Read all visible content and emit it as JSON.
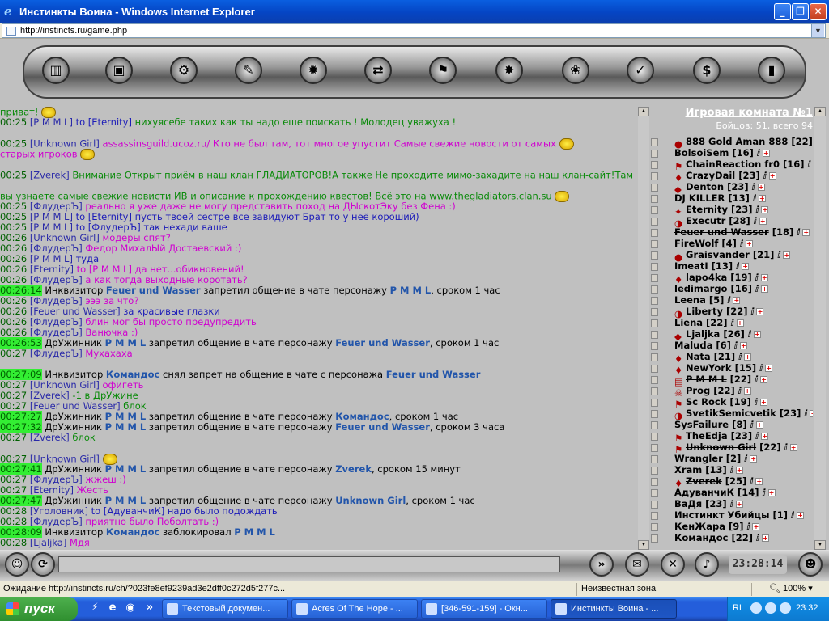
{
  "window": {
    "title": "Инстинкты Воина - Windows Internet Explorer",
    "address": "http://instincts.ru/game.php",
    "minimize": "_",
    "maximize": "❐",
    "close": "✕"
  },
  "nav": {
    "icons": [
      "rainbow-icon",
      "card-icon",
      "gear-icon",
      "sword-icon",
      "spider-icon",
      "arrows-icon",
      "flag-icon",
      "star-icon",
      "flower-icon",
      "check-icon",
      "dollar-icon",
      "door-icon"
    ],
    "glyphs": [
      "▥",
      "▣",
      "⚙",
      "✎",
      "✹",
      "⇄",
      "⚑",
      "✸",
      "❀",
      "✓",
      "$",
      "▮"
    ]
  },
  "chat": [
    {
      "time": "",
      "nick": "",
      "text": "приват!",
      "cls": "msg-gr",
      "smile": true
    },
    {
      "time": "00:25",
      "nick": "[P M M L]",
      "to": " to [Eternity] ",
      "text": "нихуясебе таких как ты надо еше поискать ! Молодец уважуха !",
      "cls": "msg-gr"
    },
    {
      "time": "",
      "nick": "",
      "text": "",
      "cls": ""
    },
    {
      "time": "00:25",
      "nick": "[Unknown Girl]",
      "text": "assassinsguild.ucoz.ru/ Кто не был там, тот многое упустит  Самые свежие новости от самых",
      "cls": "msg-mg",
      "smile": true
    },
    {
      "time": "",
      "nick": "",
      "text": "старых игроков",
      "cls": "msg-mg",
      "smile": true
    },
    {
      "time": "",
      "nick": "",
      "text": "",
      "cls": ""
    },
    {
      "time": "00:25",
      "nick": "[Zverek]",
      "text": "Внимание Открыт приём в наш клан ГЛАДИАТОРОВ!А также Не проходите мимо-захадите на наш клан-сайт!Там",
      "cls": "msg-gr",
      "smile": true
    },
    {
      "time": "",
      "nick": "",
      "text": "",
      "cls": ""
    },
    {
      "time": "",
      "nick": "",
      "text": "вы узнаете самые свежие новисти ИВ и описание к прохождению квестов! Всё это на www.thegladiators.clan.su",
      "cls": "msg-gr",
      "smile": true
    },
    {
      "time": "00:25",
      "nick": "[ФлудерЪ]",
      "text": "реально я уже даже не могу представить поход на ДЫскотЭку без Фена :)",
      "cls": "msg-mg"
    },
    {
      "time": "00:25",
      "nick": "[P M M L]",
      "to": " to [Eternity] ",
      "text": "пусть твоей сестре все завидуют Брат то у неё короший)",
      "cls": "msg-bl"
    },
    {
      "time": "00:25",
      "nick": "[P M M L]",
      "to": " to [ФлудерЪ] ",
      "text": "так нехади ваше",
      "cls": "msg-bl"
    },
    {
      "time": "00:26",
      "nick": "[Unknown Girl]",
      "text": "модеры спят?",
      "cls": "msg-mg"
    },
    {
      "time": "00:26",
      "nick": "[ФлудерЪ]",
      "text": "Федор МихалЫй Достаевский :)",
      "cls": "msg-mg"
    },
    {
      "time": "00:26",
      "nick": "[P M M L]",
      "text": "туда",
      "cls": "msg-bl"
    },
    {
      "time": "00:26",
      "nick": "[Eternity]",
      "text": "to [P M M L] да нет...обикновений!",
      "cls": "msg-mg"
    },
    {
      "time": "00:26",
      "nick": "[ФлудерЪ]",
      "text": "а как тогда выходные коротать?",
      "cls": "msg-mg"
    },
    {
      "time": "00:26:14",
      "hl": true,
      "sys": "Инквизитор ",
      "p1": "Feuer und Wasser",
      "mid": " запретил общение в чате персонажу ",
      "p2": "P M M L",
      "end": ", сроком 1 час"
    },
    {
      "time": "00:26",
      "nick": "[ФлудерЪ]",
      "text": "эээ за что?",
      "cls": "msg-mg"
    },
    {
      "time": "00:26",
      "nick": "[Feuer und Wasser]",
      "text": "за красивые глазки",
      "cls": "msg-bl"
    },
    {
      "time": "00:26",
      "nick": "[ФлудерЪ]",
      "text": "блин мог бы просто предупредить",
      "cls": "msg-mg"
    },
    {
      "time": "00:26",
      "nick": "[ФлудерЪ]",
      "text": "Ванючка :)",
      "cls": "msg-mg"
    },
    {
      "time": "00:26:53",
      "hl": true,
      "sys": "ДрУжинник ",
      "p1": "P M M L",
      "mid": " запретил общение в чате персонажу ",
      "p2": "Feuer und Wasser",
      "end": ", сроком 1 час"
    },
    {
      "time": "00:27",
      "nick": "[ФлудерЪ]",
      "text": "Мухахаха",
      "cls": "msg-mg"
    },
    {
      "time": "",
      "nick": "",
      "text": "",
      "cls": ""
    },
    {
      "time": "00:27:09",
      "hl": true,
      "sys": "Инквизитор ",
      "p1": "Командос",
      "mid": " снял запрет на общение в чате с персонажа ",
      "p2": "Feuer und Wasser",
      "end": ""
    },
    {
      "time": "00:27",
      "nick": "[Unknown Girl]",
      "text": "офигеть",
      "cls": "msg-mg"
    },
    {
      "time": "00:27",
      "nick": "[Zverek]",
      "text": "-1 в ДрУжине",
      "cls": "msg-gr"
    },
    {
      "time": "00:27",
      "nick": "[Feuer und Wasser]",
      "text": "блок",
      "cls": "msg-gr"
    },
    {
      "time": "00:27:27",
      "hl": true,
      "sys": "ДрУжинник ",
      "p1": "P M M L",
      "mid": " запретил общение в чате персонажу ",
      "p2": "Командос",
      "end": ", сроком 1 час"
    },
    {
      "time": "00:27:32",
      "hl": true,
      "sys": "ДрУжинник ",
      "p1": "P M M L",
      "mid": " запретил общение в чате персонажу ",
      "p2": "Feuer und Wasser",
      "end": ", сроком 3 часа"
    },
    {
      "time": "00:27",
      "nick": "[Zverek]",
      "text": "блок",
      "cls": "msg-gr"
    },
    {
      "time": "",
      "nick": "",
      "text": "",
      "cls": ""
    },
    {
      "time": "00:27",
      "nick": "[Unknown Girl]",
      "text": "",
      "cls": "msg-mg",
      "smile": true
    },
    {
      "time": "00:27:41",
      "hl": true,
      "sys": "ДрУжинник ",
      "p1": "P M M L",
      "mid": " запретил общение в чате персонажу ",
      "p2": "Zverek",
      "end": ", сроком 15 минут"
    },
    {
      "time": "00:27",
      "nick": "[ФлудерЪ]",
      "text": "жжеш :)",
      "cls": "msg-mg"
    },
    {
      "time": "00:27",
      "nick": "[Eternity]",
      "text": "Жесть",
      "cls": "msg-mg"
    },
    {
      "time": "00:27:47",
      "hl": true,
      "sys": "ДрУжинник ",
      "p1": "P M M L",
      "mid": " запретил общение в чате персонажу ",
      "p2": "Unknown Girl",
      "end": ", сроком 1 час"
    },
    {
      "time": "00:28",
      "nick": "[Уголовник]",
      "to": " to [АдуванчиК] ",
      "text": "надо было подождать",
      "cls": "msg-bl"
    },
    {
      "time": "00:28",
      "nick": "[ФлудерЪ]",
      "text": "приятно было Поболтать :)",
      "cls": "msg-mg"
    },
    {
      "time": "00:28:09",
      "hl": true,
      "sys": "Инквизитор ",
      "p1": "Командос",
      "mid": " заблокировал ",
      "p2": "P M M L",
      "end": ""
    },
    {
      "time": "00:28",
      "nick": "[Ljaljka]",
      "text": "Мдя",
      "cls": "msg-mg"
    }
  ],
  "room": {
    "title": "Игровая комната №1",
    "stats": "Бойцов: 51, всего 94"
  },
  "players": [
    {
      "name": "888 Gold Aman 888",
      "lvl": "[22]",
      "icon": "clan"
    },
    {
      "name": "BolsoiSem",
      "lvl": "[16]",
      "icon": ""
    },
    {
      "name": "ChainReaction fr0",
      "lvl": "[16]",
      "icon": "ghost"
    },
    {
      "name": "CrazyDail",
      "lvl": "[23]",
      "icon": "shield"
    },
    {
      "name": "Denton",
      "lvl": "[23]",
      "icon": "clan2"
    },
    {
      "name": "DJ KILLER",
      "lvl": "[13]",
      "icon": ""
    },
    {
      "name": "Eternity",
      "lvl": "[23]",
      "icon": "clan3"
    },
    {
      "name": "Executr",
      "lvl": "[28]",
      "icon": "clan4"
    },
    {
      "name": "Feuer und Wasser",
      "lvl": "[18]",
      "icon": "",
      "strike": true
    },
    {
      "name": "FireWolf",
      "lvl": "[4]",
      "icon": ""
    },
    {
      "name": "Graisvander",
      "lvl": "[21]",
      "icon": "clan"
    },
    {
      "name": "ImeatI",
      "lvl": "[13]",
      "icon": ""
    },
    {
      "name": "lapo4ka",
      "lvl": "[19]",
      "icon": "shield"
    },
    {
      "name": "ledimargo",
      "lvl": "[16]",
      "icon": ""
    },
    {
      "name": "Leena",
      "lvl": "[5]",
      "icon": ""
    },
    {
      "name": "Liberty",
      "lvl": "[22]",
      "icon": "clan4"
    },
    {
      "name": "Liena",
      "lvl": "[22]",
      "icon": ""
    },
    {
      "name": "Ljaljka",
      "lvl": "[26]",
      "icon": "clan2"
    },
    {
      "name": "Maluda",
      "lvl": "[6]",
      "icon": ""
    },
    {
      "name": "Nata",
      "lvl": "[21]",
      "icon": "shield"
    },
    {
      "name": "NewYork",
      "lvl": "[15]",
      "icon": "shield"
    },
    {
      "name": "P M M L",
      "lvl": "[22]",
      "icon": "clan5",
      "strike": true
    },
    {
      "name": "Prog",
      "lvl": "[22]",
      "icon": "skull"
    },
    {
      "name": "Sc Rock",
      "lvl": "[19]",
      "icon": "ghost"
    },
    {
      "name": "SvetikSemicvetik",
      "lvl": "[23]",
      "icon": "clan4"
    },
    {
      "name": "SysFailure",
      "lvl": "[8]",
      "icon": ""
    },
    {
      "name": "TheEdja",
      "lvl": "[23]",
      "icon": "ghost"
    },
    {
      "name": "Unknown Girl",
      "lvl": "[22]",
      "icon": "ghost",
      "strike": true
    },
    {
      "name": "Wrangler",
      "lvl": "[2]",
      "icon": ""
    },
    {
      "name": "Xram",
      "lvl": "[13]",
      "icon": ""
    },
    {
      "name": "Zverek",
      "lvl": "[25]",
      "icon": "shield",
      "strike": true
    },
    {
      "name": "АдуванчиК",
      "lvl": "[14]",
      "icon": ""
    },
    {
      "name": "ВаДя",
      "lvl": "[23]",
      "icon": ""
    },
    {
      "name": "Инстинкт Убийцы",
      "lvl": "[1]",
      "icon": ""
    },
    {
      "name": "КенЖара",
      "lvl": "[9]",
      "icon": ""
    },
    {
      "name": "Командос",
      "lvl": "[22]",
      "icon": ""
    }
  ],
  "bottom": {
    "clock": "23:28:14",
    "left_icons": [
      "smile-face-icon"
    ],
    "right_icons": [
      "fast-forward-icon",
      "chat-bubble-icon",
      "x-circle-icon",
      "sound-icon",
      "smile-icon"
    ]
  },
  "status": {
    "loading": "Ожидание http://instincts.ru/ch/?023fe8ef9239ad3e2dff0c272d5f277c...",
    "zone": "Неизвестная зона",
    "zoom": "100%"
  },
  "taskbar": {
    "start": "пуск",
    "tasks": [
      "Текстовый докумен...",
      "Acres Of The Hope - ...",
      "[346-591-159] - Окн...",
      "Инстинкты Воина - ..."
    ],
    "lang": "RL",
    "time": "23:32"
  },
  "colors": {
    "chat_bg": "#c0c0c0",
    "timestamp_hl": "#33ee33",
    "nick": "#2a2aa8",
    "magenta": "#d000d0",
    "green": "#0a8a0a",
    "titlebar": "#0a5fe0"
  }
}
